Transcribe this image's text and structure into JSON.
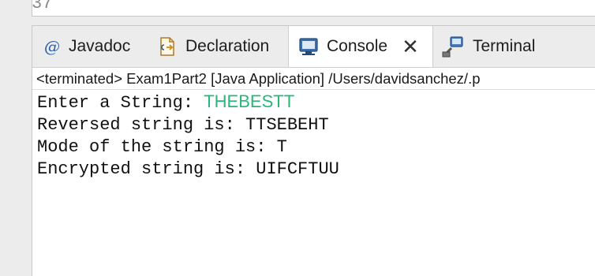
{
  "editor": {
    "line_number": "37"
  },
  "tabs": [
    {
      "label": "Javadoc",
      "icon": "at-icon"
    },
    {
      "label": "Declaration",
      "icon": "declaration-icon"
    },
    {
      "label": "Console",
      "icon": "console-icon",
      "active": true
    },
    {
      "label": "Terminal",
      "icon": "terminal-icon"
    }
  ],
  "console": {
    "status": "<terminated> Exam1Part2 [Java Application] /Users/davidsanchez/.p",
    "lines": [
      {
        "prompt": "Enter a String: ",
        "input": "THEBESTT"
      },
      {
        "text": "Reversed string is: TTSEBEHT"
      },
      {
        "text": "Mode of the string is: T"
      },
      {
        "text": "Encrypted string is: UIFCFTUU"
      }
    ],
    "input_color": "#28b779"
  }
}
